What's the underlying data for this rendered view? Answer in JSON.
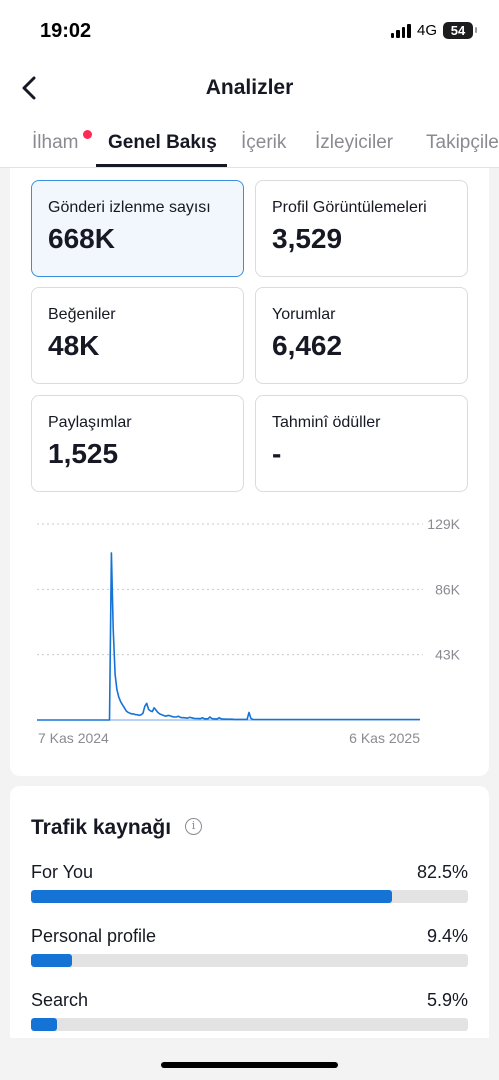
{
  "status_bar": {
    "time": "19:02",
    "network": "4G",
    "battery": "54"
  },
  "header": {
    "title": "Analizler",
    "back_icon": "chevron-left-icon"
  },
  "tabs": [
    {
      "label": "İlham",
      "has_dot": true
    },
    {
      "label": "Genel Bakış",
      "active": true
    },
    {
      "label": "İçerik"
    },
    {
      "label": "İzleyiciler"
    },
    {
      "label": "Takipçiler"
    }
  ],
  "metrics": [
    {
      "label": "Gönderi izlenme sayısı",
      "value": "668K",
      "selected": true
    },
    {
      "label": "Profil Görüntülemeleri",
      "value": "3,529"
    },
    {
      "label": "Beğeniler",
      "value": "48K"
    },
    {
      "label": "Yorumlar",
      "value": "6,462"
    },
    {
      "label": "Paylaşımlar",
      "value": "1,525"
    },
    {
      "label": "Tahminî ödüller",
      "value": "-"
    }
  ],
  "chart_data": {
    "type": "line",
    "title": "",
    "xlabel": "",
    "ylabel": "",
    "x_start_label": "7 Kas 2024",
    "x_end_label": "6 Kas 2025",
    "y_tick_labels": [
      "129K",
      "86K",
      "43K"
    ],
    "y_ticks": [
      129000,
      86000,
      43000
    ],
    "ylim": [
      0,
      129000
    ],
    "grid": true,
    "series": [
      {
        "color": "#1673d6",
        "values": [
          0,
          0,
          0,
          0,
          0,
          0,
          0,
          0,
          0,
          0,
          0,
          0,
          0,
          0,
          0,
          0,
          0,
          0,
          0,
          0,
          0,
          0,
          0,
          0,
          0,
          0,
          0,
          0,
          0,
          0,
          0,
          0,
          0,
          0,
          0,
          0,
          0,
          0,
          0,
          0,
          110000,
          60000,
          30000,
          20000,
          15000,
          12000,
          10000,
          8000,
          6000,
          5000,
          4500,
          4000,
          4000,
          3500,
          3500,
          3000,
          3500,
          4500,
          9000,
          11000,
          7000,
          6000,
          5500,
          8000,
          6500,
          5000,
          4000,
          3500,
          3000,
          2500,
          2800,
          3000,
          2500,
          2200,
          2000,
          2000,
          2500,
          1800,
          1500,
          1500,
          1400,
          1200,
          1800,
          1500,
          1200,
          1000,
          1000,
          900,
          900,
          1500,
          800,
          800,
          800,
          2000,
          1000,
          800,
          700,
          700,
          1500,
          800,
          600,
          600,
          500,
          500,
          500,
          500,
          400,
          400,
          400,
          400,
          400,
          400,
          400,
          400,
          5000,
          1200,
          400,
          300,
          300,
          300,
          300,
          300,
          300,
          300,
          300,
          300,
          300,
          300,
          300,
          300,
          300,
          300,
          300,
          300,
          300,
          300,
          300,
          300,
          300,
          300,
          300,
          300,
          300,
          300,
          300,
          300,
          300,
          300,
          300,
          300,
          300,
          300,
          300,
          300,
          300,
          300,
          300,
          300,
          300,
          300,
          300,
          300,
          300,
          300,
          300,
          300,
          300,
          300,
          300,
          300,
          300,
          300,
          300,
          300,
          300,
          300,
          300,
          300,
          300,
          300,
          300,
          300,
          300,
          300,
          300,
          300,
          300,
          300,
          300,
          300,
          300,
          300,
          300,
          300,
          300,
          300,
          300,
          300,
          300,
          300,
          300,
          300,
          300,
          300,
          300,
          300,
          300
        ]
      }
    ]
  },
  "traffic": {
    "title": "Trafik kaynağı",
    "info_icon": "info-icon",
    "sources": [
      {
        "name": "For You",
        "pct_label": "82.5%",
        "pct": 82.5
      },
      {
        "name": "Personal profile",
        "pct_label": "9.4%",
        "pct": 9.4
      },
      {
        "name": "Search",
        "pct_label": "5.9%",
        "pct": 5.9
      }
    ]
  }
}
